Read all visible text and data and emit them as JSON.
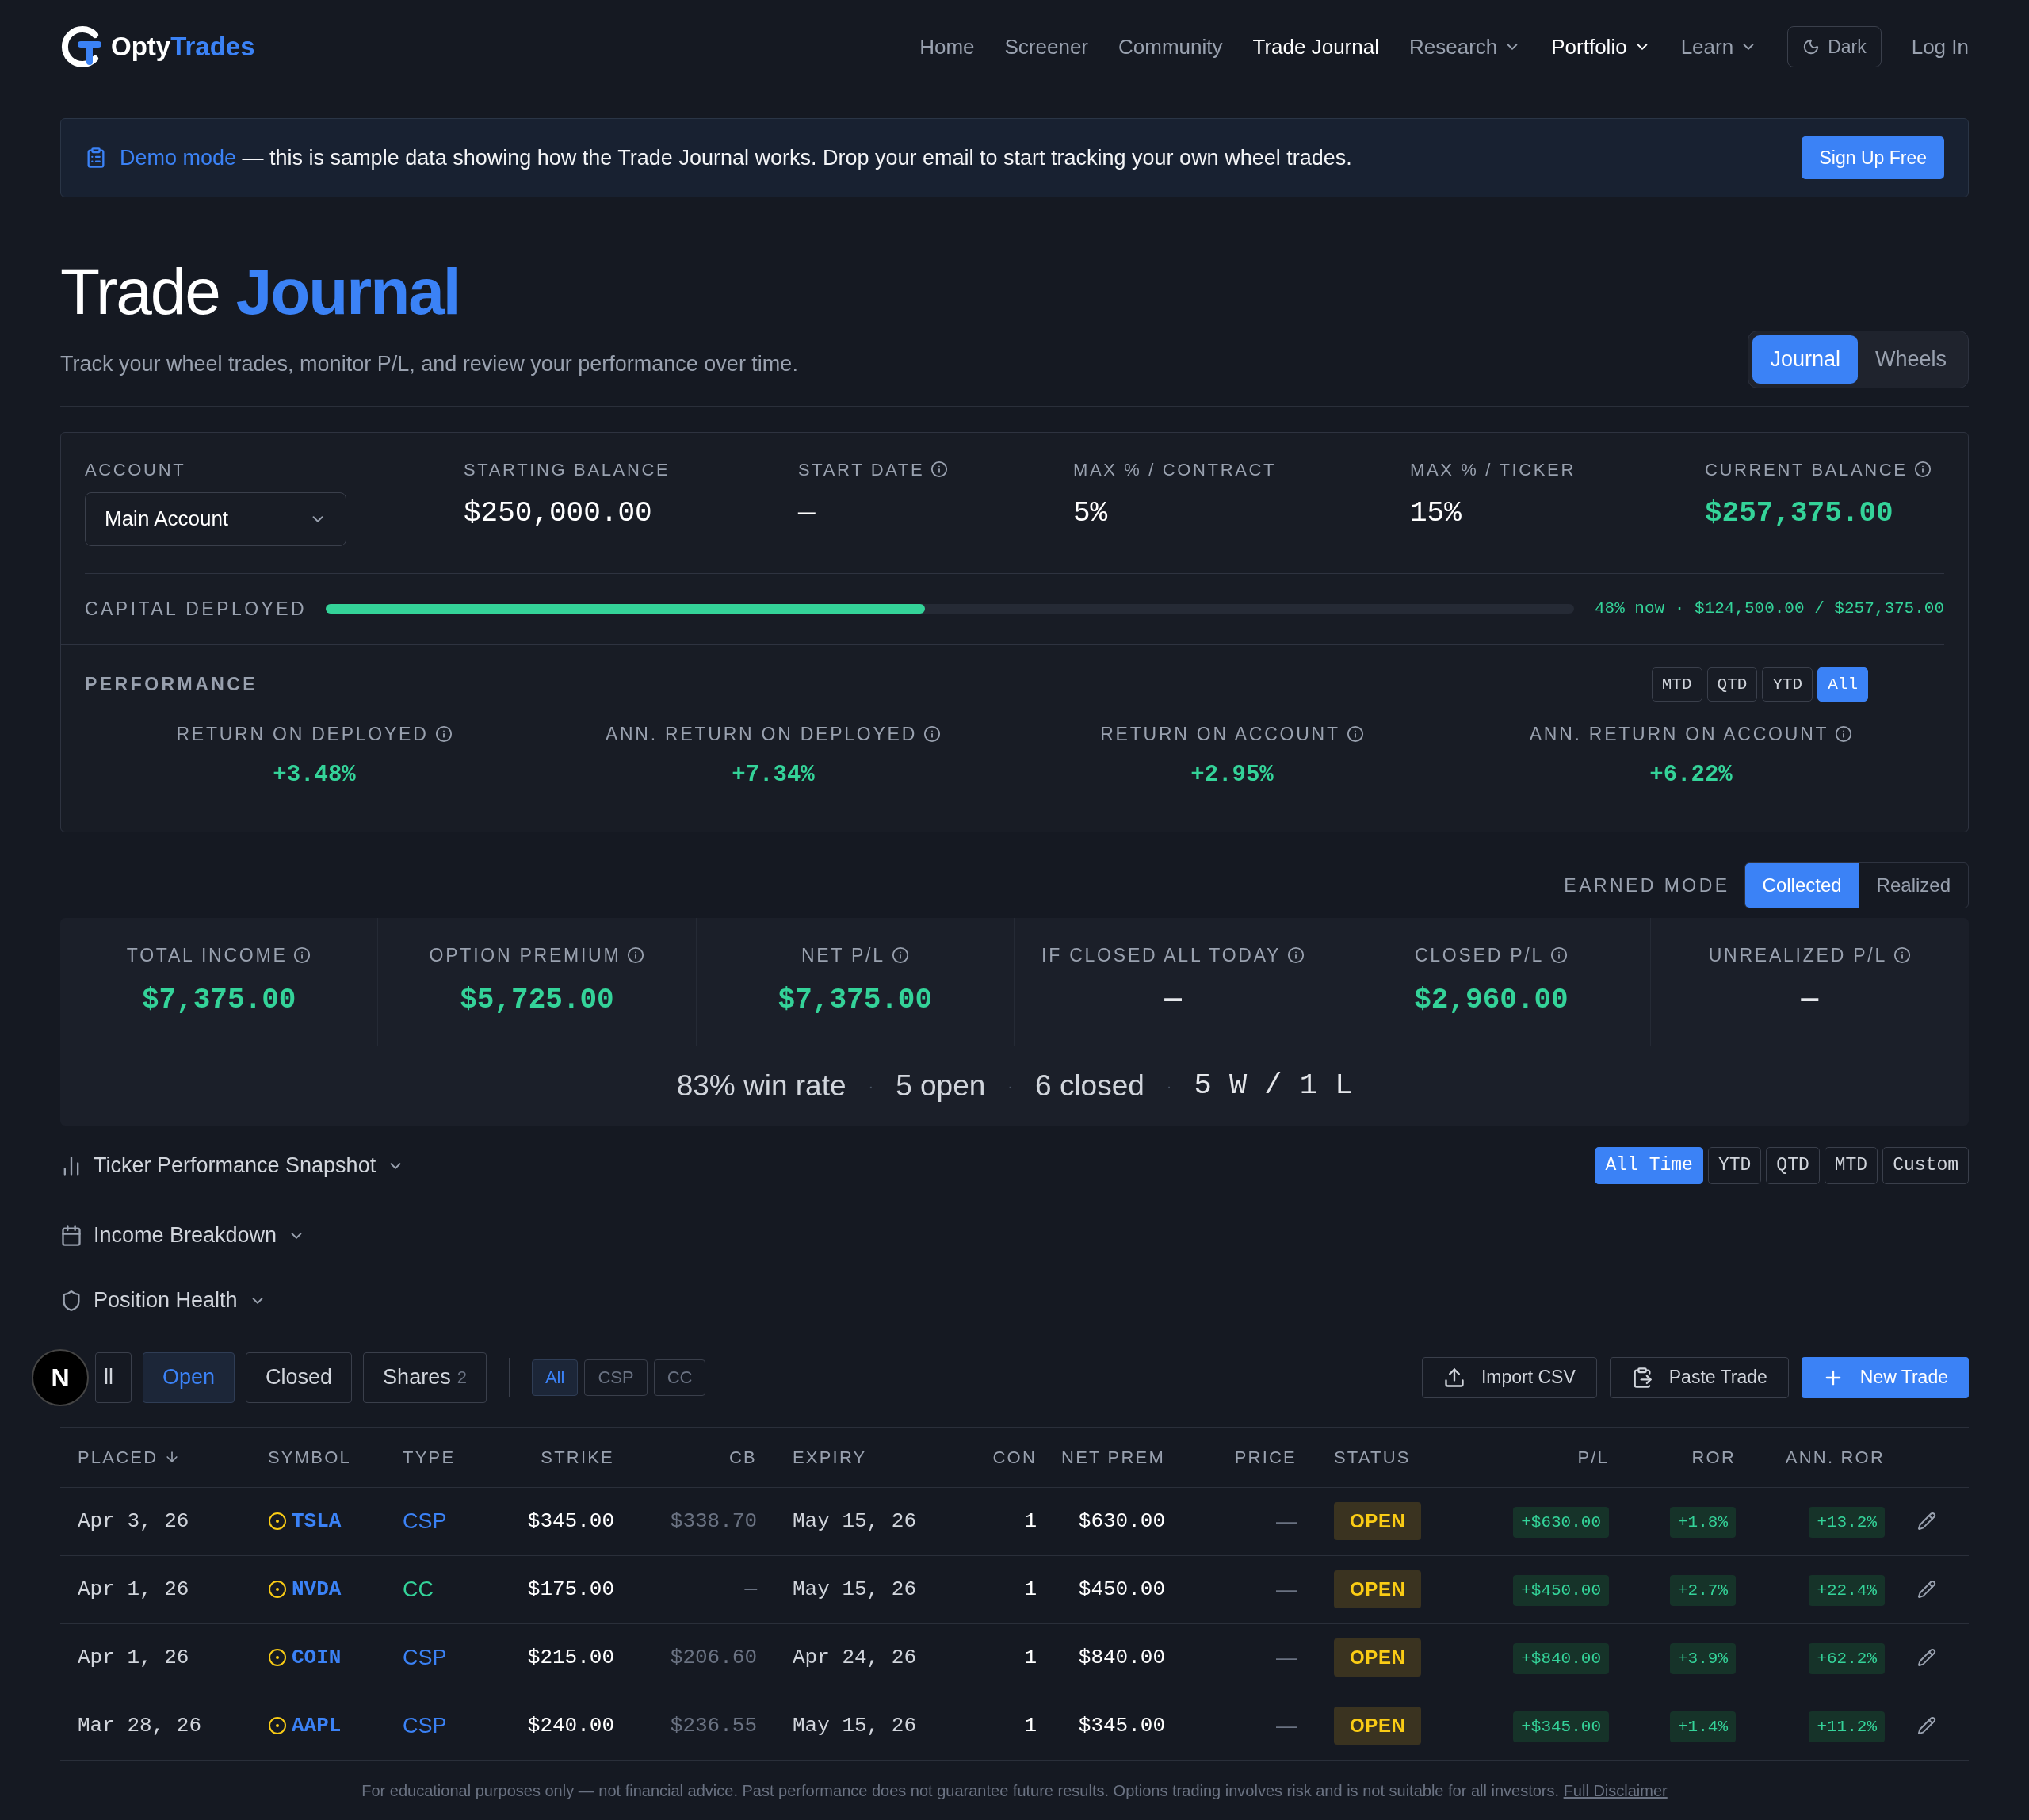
{
  "nav": {
    "brand_first": "Opty",
    "brand_second": "Trades",
    "links": [
      {
        "label": "Home",
        "selected": false,
        "dropdown": false
      },
      {
        "label": "Screener",
        "selected": false,
        "dropdown": false
      },
      {
        "label": "Community",
        "selected": false,
        "dropdown": false
      },
      {
        "label": "Trade Journal",
        "selected": true,
        "dropdown": false
      },
      {
        "label": "Research",
        "selected": false,
        "dropdown": true
      },
      {
        "label": "Portfolio",
        "selected": true,
        "dropdown": true
      },
      {
        "label": "Learn",
        "selected": false,
        "dropdown": true
      }
    ],
    "theme_button": "Dark",
    "login": "Log In"
  },
  "banner": {
    "link": "Demo mode",
    "text": "— this is sample data showing how the Trade Journal works. Drop your email to start tracking your own wheel trades.",
    "button": "Sign Up Free"
  },
  "header": {
    "title": "Trade",
    "title_accent": "Journal",
    "subtitle": "Track your wheel trades, monitor P/L, and review your performance over time.",
    "views": [
      {
        "label": "Journal",
        "selected": true
      },
      {
        "label": "Wheels",
        "selected": false
      }
    ]
  },
  "account": {
    "fields": [
      {
        "kind": "select",
        "label": "ACCOUNT",
        "value": "Main Account",
        "info": false
      },
      {
        "kind": "text",
        "label": "STARTING BALANCE",
        "value": "$250,000.00",
        "info": false,
        "highlight": false
      },
      {
        "kind": "text",
        "label": "START DATE",
        "value": "—",
        "info": true,
        "highlight": false
      },
      {
        "kind": "text",
        "label": "MAX % / CONTRACT",
        "value": "5%",
        "info": false,
        "highlight": false
      },
      {
        "kind": "text",
        "label": "MAX % / TICKER",
        "value": "15%",
        "info": false,
        "highlight": false
      },
      {
        "kind": "text",
        "label": "CURRENT BALANCE",
        "value": "$257,375.00",
        "info": true,
        "highlight": true
      }
    ],
    "capital": {
      "label": "CAPITAL DEPLOYED",
      "level": 0.48,
      "reading": "48% now · $124,500.00 / $257,375.00"
    }
  },
  "performance": {
    "title": "PERFORMANCE",
    "periods": [
      {
        "label": "MTD",
        "selected": false
      },
      {
        "label": "QTD",
        "selected": false
      },
      {
        "label": "YTD",
        "selected": false
      },
      {
        "label": "All",
        "selected": true
      }
    ],
    "metrics": [
      {
        "label": "RETURN ON DEPLOYED",
        "value": "+3.48%"
      },
      {
        "label": "ANN. RETURN ON DEPLOYED",
        "value": "+7.34%"
      },
      {
        "label": "RETURN ON ACCOUNT",
        "value": "+2.95%"
      },
      {
        "label": "ANN. RETURN ON ACCOUNT",
        "value": "+6.22%"
      }
    ]
  },
  "earned_mode": {
    "label": "EARNED MODE",
    "options": [
      {
        "label": "Collected",
        "selected": true
      },
      {
        "label": "Realized",
        "selected": false
      }
    ]
  },
  "stats": [
    {
      "label": "TOTAL INCOME",
      "value": "$7,375.00",
      "highlight": true
    },
    {
      "label": "OPTION PREMIUM",
      "value": "$5,725.00",
      "highlight": true
    },
    {
      "label": "NET P/L",
      "value": "$7,375.00",
      "highlight": true
    },
    {
      "label": "IF CLOSED ALL TODAY",
      "value": "—",
      "highlight": false
    },
    {
      "label": "CLOSED P/L",
      "value": "$2,960.00",
      "highlight": true
    },
    {
      "label": "UNREALIZED P/L",
      "value": "—",
      "highlight": false
    }
  ],
  "summary": {
    "parts": [
      "83% win rate",
      "5 open",
      "6 closed"
    ],
    "separator": "·",
    "record": "5 W / 1 L"
  },
  "sections": [
    {
      "kind": "chart",
      "label": "Ticker Performance Snapshot"
    },
    {
      "kind": "calendar",
      "label": "Income Breakdown"
    },
    {
      "kind": "shield",
      "label": "Position Health"
    }
  ],
  "ticker_ranges": [
    {
      "label": "All Time",
      "selected": true
    },
    {
      "label": "YTD",
      "selected": false
    },
    {
      "label": "QTD",
      "selected": false
    },
    {
      "label": "MTD",
      "selected": false
    },
    {
      "label": "Custom",
      "selected": false
    }
  ],
  "filters": {
    "tabs": [
      {
        "label": "ll",
        "selected": false
      },
      {
        "label": "Open",
        "selected": true
      },
      {
        "label": "Closed",
        "selected": false
      },
      {
        "label": "Shares",
        "count": "2",
        "selected": false
      }
    ],
    "types": [
      {
        "label": "All",
        "selected": true
      },
      {
        "label": "CSP",
        "selected": false
      },
      {
        "label": "CC",
        "selected": false
      }
    ],
    "actions": [
      {
        "kind": "import",
        "label": "Import CSV"
      },
      {
        "kind": "paste",
        "label": "Paste Trade"
      },
      {
        "kind": "new",
        "label": "New Trade"
      }
    ]
  },
  "dev_badge": "N",
  "table": {
    "columns": [
      "PLACED",
      "SYMBOL",
      "TYPE",
      "STRIKE",
      "CB",
      "EXPIRY",
      "CON",
      "NET PREM",
      "PRICE",
      "STATUS",
      "P/L",
      "ROR",
      "ANN. ROR"
    ],
    "rows": [
      {
        "placed": "Apr 3, 26",
        "symbol": "TSLA",
        "type": {
          "label": "CSP",
          "color": "#3b82f6"
        },
        "strike": "$345.00",
        "cb": "$338.70",
        "expiry": "May 15, 26",
        "con": "1",
        "net_prem": "$630.00",
        "price": "—",
        "status": "OPEN",
        "pl": "+$630.00",
        "ror": "+1.8%",
        "ann_ror": "+13.2%"
      },
      {
        "placed": "Apr 1, 26",
        "symbol": "NVDA",
        "type": {
          "label": "CC",
          "color": "#34d399"
        },
        "strike": "$175.00",
        "cb": "—",
        "expiry": "May 15, 26",
        "con": "1",
        "net_prem": "$450.00",
        "price": "—",
        "status": "OPEN",
        "pl": "+$450.00",
        "ror": "+2.7%",
        "ann_ror": "+22.4%"
      },
      {
        "placed": "Apr 1, 26",
        "symbol": "COIN",
        "type": {
          "label": "CSP",
          "color": "#3b82f6"
        },
        "strike": "$215.00",
        "cb": "$206.60",
        "expiry": "Apr 24, 26",
        "con": "1",
        "net_prem": "$840.00",
        "price": "—",
        "status": "OPEN",
        "pl": "+$840.00",
        "ror": "+3.9%",
        "ann_ror": "+62.2%"
      },
      {
        "placed": "Mar 28, 26",
        "symbol": "AAPL",
        "type": {
          "label": "CSP",
          "color": "#3b82f6"
        },
        "strike": "$240.00",
        "cb": "$236.55",
        "expiry": "May 15, 26",
        "con": "1",
        "net_prem": "$345.00",
        "price": "—",
        "status": "OPEN",
        "pl": "+$345.00",
        "ror": "+1.4%",
        "ann_ror": "+11.2%"
      }
    ]
  },
  "footer": {
    "text": "For educational purposes only — not financial advice. Past performance does not guarantee future results. Options trading involves risk and is not suitable for all investors.",
    "link": "Full Disclaimer"
  }
}
